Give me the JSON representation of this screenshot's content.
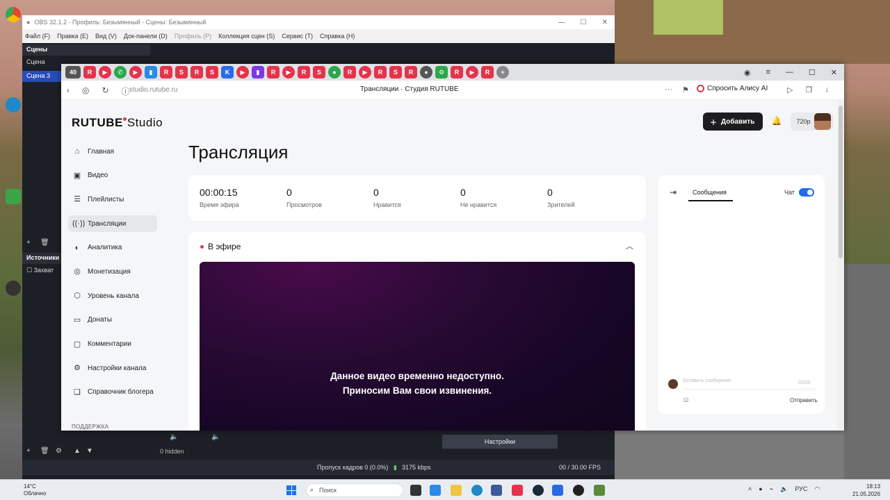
{
  "obs": {
    "title": "OBS 32.1.2 - Профиль: Безымянный - Сцены: Безымянный",
    "menu": [
      "Файл (F)",
      "Правка (E)",
      "Вид (V)",
      "Док-панели (D)",
      "Профиль (P)",
      "Коллекция сцен (S)",
      "Сервис (T)",
      "Справка (H)"
    ],
    "scenes_header": "Сцены",
    "scenes": [
      "Сцена",
      "Сцена 3"
    ],
    "sources_header": "Источники",
    "source_item": "Захват",
    "hidden": "0 hidden",
    "settings_button": "Настройки",
    "dropped_frames": "Пропуск кадров 0 (0.0%)",
    "bitrate": "3175 kbps",
    "fps": "00 / 30.00 FPS"
  },
  "browser": {
    "url": "studio.rutube.ru",
    "page_title": "Трансляции · Студия RUTUBE",
    "alisa_button": "Спросить Алису AI",
    "tab_active_badge": "40"
  },
  "studio": {
    "logo_main": "RUTUBE",
    "logo_sub": "Studio",
    "nav": [
      {
        "label": "Главная",
        "icon": "home-icon"
      },
      {
        "label": "Видео",
        "icon": "video-icon"
      },
      {
        "label": "Плейлисты",
        "icon": "playlist-icon"
      },
      {
        "label": "Трансляции",
        "icon": "broadcast-icon",
        "active": true
      },
      {
        "label": "Аналитика",
        "icon": "analytics-icon"
      },
      {
        "label": "Монетизация",
        "icon": "monetization-icon"
      },
      {
        "label": "Уровень канала",
        "icon": "channel-level-icon"
      },
      {
        "label": "Донаты",
        "icon": "donate-icon"
      },
      {
        "label": "Комментарии",
        "icon": "comments-icon"
      },
      {
        "label": "Настройки канала",
        "icon": "settings-icon"
      },
      {
        "label": "Справочник блогера",
        "icon": "guide-icon"
      }
    ],
    "support": "ПОДДЕРЖКА",
    "heading": "Трансляция",
    "add_button": "Добавить",
    "quality": "720p",
    "stats": [
      {
        "value": "00:00:15",
        "label": "Время эфира"
      },
      {
        "value": "0",
        "label": "Просмотров"
      },
      {
        "value": "0",
        "label": "Нравится"
      },
      {
        "value": "0",
        "label": "Не нравится"
      },
      {
        "value": "0",
        "label": "Зрителей"
      }
    ],
    "live_label": "В эфире",
    "player_message_1": "Данное видео временно недоступно.",
    "player_message_2": "Приносим Вам свои извинения.",
    "chat": {
      "tab_messages": "Сообщения",
      "chat_label": "Чат",
      "input_placeholder": "Оставить сообщение",
      "counter": "0/200",
      "send": "Отправить"
    }
  },
  "taskbar": {
    "temperature": "14°C",
    "weather": "Облачно",
    "search": "Поиск",
    "lang": "РУС",
    "time": "18:13",
    "date": "21.05.2026"
  },
  "colors": {
    "accent_red": "#e5334b",
    "toggle_blue": "#1c6ef2",
    "dark_button": "#1d1d1f"
  }
}
